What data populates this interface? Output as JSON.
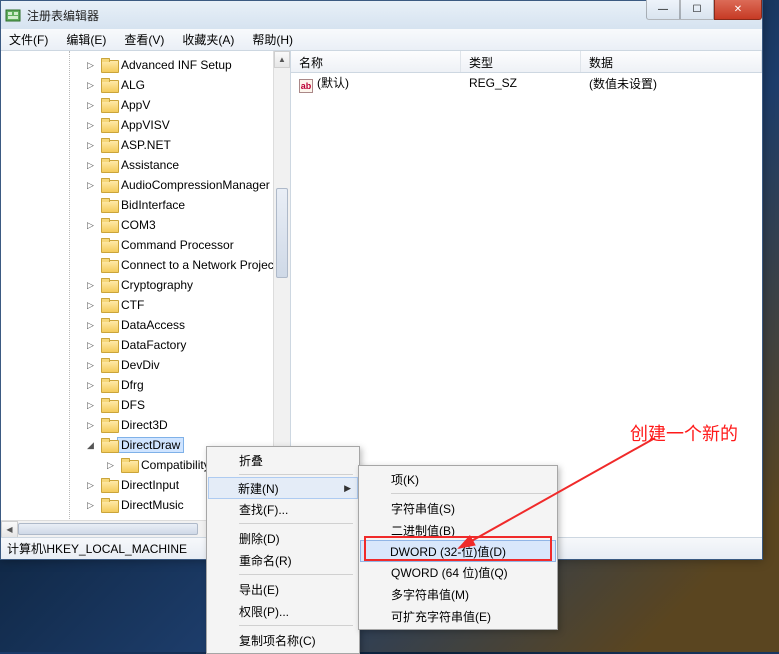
{
  "window": {
    "title": "注册表编辑器"
  },
  "menu": {
    "file": "文件(F)",
    "edit": "编辑(E)",
    "view": "查看(V)",
    "favorites": "收藏夹(A)",
    "help": "帮助(H)"
  },
  "columns": {
    "name": "名称",
    "type": "类型",
    "data": "数据"
  },
  "row0": {
    "name": "(默认)",
    "type": "REG_SZ",
    "data": "(数值未设置)"
  },
  "tree": [
    {
      "label": "Advanced INF Setup",
      "expandable": true
    },
    {
      "label": "ALG",
      "expandable": true
    },
    {
      "label": "AppV",
      "expandable": true
    },
    {
      "label": "AppVISV",
      "expandable": true
    },
    {
      "label": "ASP.NET",
      "expandable": true
    },
    {
      "label": "Assistance",
      "expandable": true
    },
    {
      "label": "AudioCompressionManager",
      "expandable": true
    },
    {
      "label": "BidInterface",
      "expandable": false
    },
    {
      "label": "COM3",
      "expandable": true
    },
    {
      "label": "Command Processor",
      "expandable": false
    },
    {
      "label": "Connect to a Network Projector",
      "expandable": false
    },
    {
      "label": "Cryptography",
      "expandable": true
    },
    {
      "label": "CTF",
      "expandable": true
    },
    {
      "label": "DataAccess",
      "expandable": true
    },
    {
      "label": "DataFactory",
      "expandable": true
    },
    {
      "label": "DevDiv",
      "expandable": true
    },
    {
      "label": "Dfrg",
      "expandable": true
    },
    {
      "label": "DFS",
      "expandable": true
    },
    {
      "label": "Direct3D",
      "expandable": true
    },
    {
      "label": "DirectDraw",
      "expandable": true,
      "selected": true,
      "open": true
    },
    {
      "label": "Compatibility",
      "expandable": true,
      "depth": 2
    },
    {
      "label": "DirectInput",
      "expandable": true
    },
    {
      "label": "DirectMusic",
      "expandable": true
    }
  ],
  "status": {
    "path": "计算机\\HKEY_LOCAL_MACHINE"
  },
  "ctx1": {
    "collapse": "折叠",
    "new": "新建(N)",
    "find": "查找(F)...",
    "delete": "删除(D)",
    "rename": "重命名(R)",
    "export": "导出(E)",
    "permissions": "权限(P)...",
    "copykey": "复制项名称(C)"
  },
  "ctx2": {
    "key": "项(K)",
    "string": "字符串值(S)",
    "binary": "二进制值(B)",
    "dword": "DWORD (32-位)值(D)",
    "qword": "QWORD (64 位)值(Q)",
    "multi": "多字符串值(M)",
    "expand": "可扩充字符串值(E)"
  },
  "annotation": "创建一个新的"
}
